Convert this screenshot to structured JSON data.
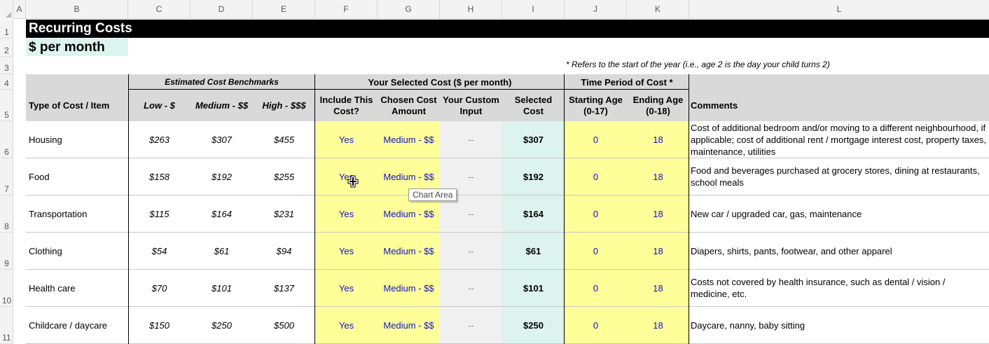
{
  "column_letters": [
    "A",
    "B",
    "C",
    "D",
    "E",
    "F",
    "G",
    "H",
    "I",
    "J",
    "K",
    "L"
  ],
  "row_numbers": [
    "1",
    "2",
    "3",
    "4",
    "5",
    "6",
    "7",
    "8",
    "9",
    "10",
    "11"
  ],
  "title": "Recurring Costs",
  "subtitle": "$ per month",
  "note": "* Refers to the start of the year (i.e., age 2 is the day your child turns 2)",
  "groups": {
    "benchmarks": "Estimated Cost Benchmarks",
    "selected": "Your Selected Cost ($ per month)",
    "period": "Time Period of Cost *"
  },
  "headers": {
    "type": "Type of Cost / Item",
    "low": "Low - $",
    "medium": "Medium - $$",
    "high": "High - $$$",
    "include": "Include This Cost?",
    "chosen": "Chosen Cost Amount",
    "custom": "Your Custom Input",
    "selected_cost": "Selected Cost",
    "start_age": "Starting Age (0-17)",
    "end_age": "Ending Age (0-18)",
    "comments": "Comments"
  },
  "rows": [
    {
      "item": "Housing",
      "low": "$263",
      "medium": "$307",
      "high": "$455",
      "include": "Yes",
      "chosen": "Medium - $$",
      "custom": "--",
      "selected": "$307",
      "start": "0",
      "end": "18",
      "comment": "Cost of additional bedroom and/or moving to a different neighbourhood, if applicable; cost of additional rent / mortgage interest cost, property taxes, maintenance, utilities"
    },
    {
      "item": "Food",
      "low": "$158",
      "medium": "$192",
      "high": "$255",
      "include": "Yes",
      "chosen": "Medium - $$",
      "custom": "--",
      "selected": "$192",
      "start": "0",
      "end": "18",
      "comment": "Food and beverages purchased at grocery stores, dining at restaurants, school meals"
    },
    {
      "item": "Transportation",
      "low": "$115",
      "medium": "$164",
      "high": "$231",
      "include": "Yes",
      "chosen": "Medium - $$",
      "custom": "--",
      "selected": "$164",
      "start": "0",
      "end": "18",
      "comment": "New car / upgraded car, gas, maintenance"
    },
    {
      "item": "Clothing",
      "low": "$54",
      "medium": "$61",
      "high": "$94",
      "include": "Yes",
      "chosen": "Medium - $$",
      "custom": "--",
      "selected": "$61",
      "start": "0",
      "end": "18",
      "comment": "Diapers, shirts, pants, footwear, and other apparel"
    },
    {
      "item": "Health care",
      "low": "$70",
      "medium": "$101",
      "high": "$137",
      "include": "Yes",
      "chosen": "Medium - $$",
      "custom": "--",
      "selected": "$101",
      "start": "0",
      "end": "18",
      "comment": "Costs not covered by health insurance, such as dental / vision / medicine, etc."
    },
    {
      "item": "Childcare / daycare",
      "low": "$150",
      "medium": "$250",
      "high": "$500",
      "include": "Yes",
      "chosen": "Medium - $$",
      "custom": "--",
      "selected": "$250",
      "start": "0",
      "end": "18",
      "comment": "Daycare, nanny, baby sitting"
    }
  ],
  "tooltip": "Chart Area",
  "cursor_icon": "plus-cross-cursor-icon"
}
